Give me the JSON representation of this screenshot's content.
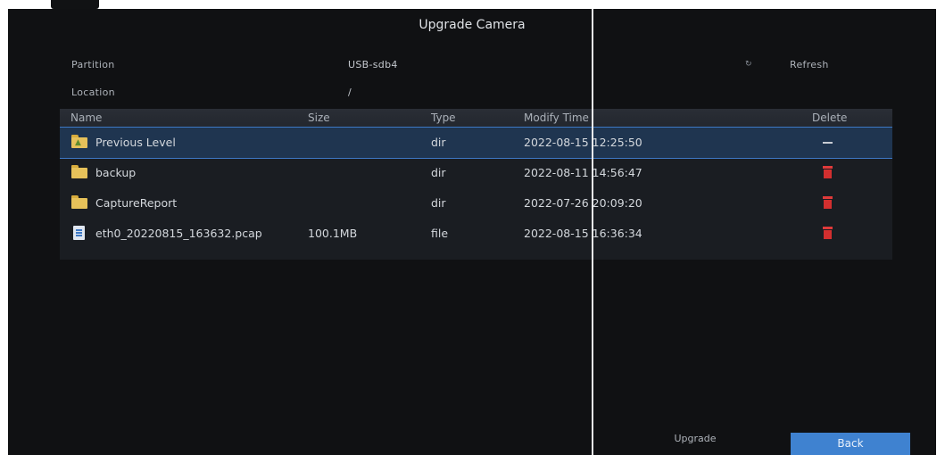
{
  "dialog": {
    "title": "Upgrade Camera",
    "partition_label": "Partition",
    "partition_value": "USB-sdb4",
    "location_label": "Location",
    "location_value": "/",
    "refresh_label": "Refresh",
    "refresh_icon": "refresh-icon"
  },
  "table": {
    "headers": {
      "name": "Name",
      "size": "Size",
      "type": "Type",
      "modify_time": "Modify Time",
      "delete": "Delete"
    },
    "rows": [
      {
        "name": "Previous Level",
        "size": "",
        "type": "dir",
        "modify_time": "2022-08-15 12:25:50",
        "icon": "folder-up-icon",
        "delete": "none"
      },
      {
        "name": "backup",
        "size": "",
        "type": "dir",
        "modify_time": "2022-08-11 14:56:47",
        "icon": "folder-icon",
        "delete": "trash-icon"
      },
      {
        "name": "CaptureReport",
        "size": "",
        "type": "dir",
        "modify_time": "2022-07-26 20:09:20",
        "icon": "folder-icon",
        "delete": "trash-icon"
      },
      {
        "name": "eth0_20220815_163632.pcap",
        "size": "100.1MB",
        "type": "file",
        "modify_time": "2022-08-15 16:36:34",
        "icon": "file-icon",
        "delete": "trash-icon"
      }
    ]
  },
  "buttons": {
    "upgrade": "Upgrade",
    "back": "Back"
  },
  "colors": {
    "background": "#101113",
    "selection": "#1f3550",
    "accent": "#3f82d0",
    "delete": "#d22f2f",
    "folder": "#e6c15a"
  }
}
